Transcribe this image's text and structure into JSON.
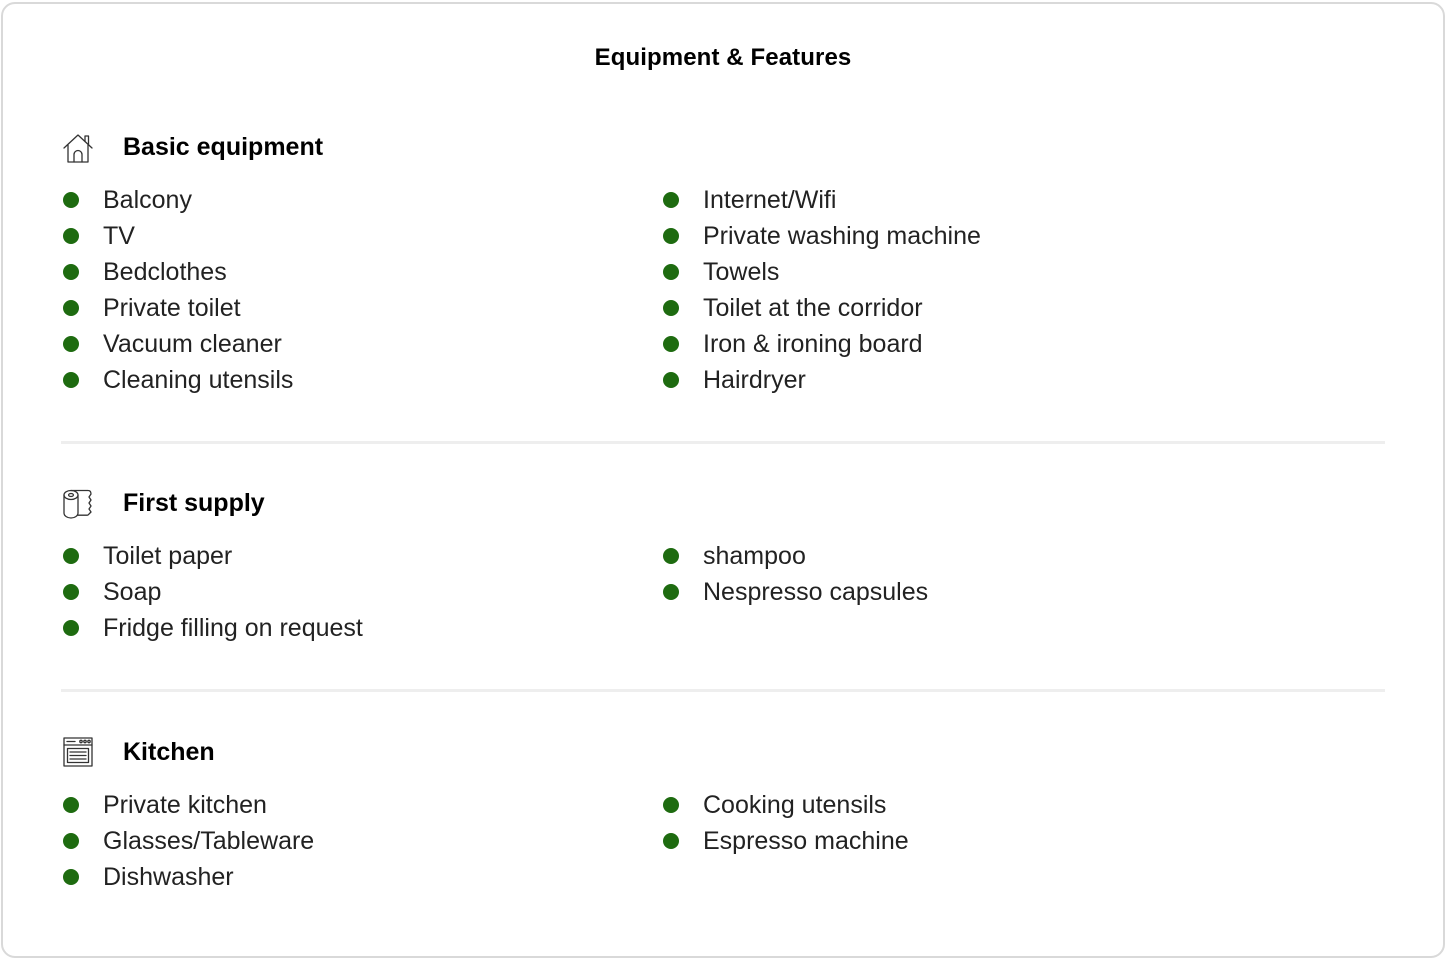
{
  "title": "Equipment & Features",
  "colors": {
    "bullet": "#1e6b10",
    "divider": "#eeeeee",
    "border": "#d9d9d9"
  },
  "sections": [
    {
      "icon": "house-icon",
      "title": "Basic equipment",
      "left": [
        "Balcony",
        "TV",
        "Bedclothes",
        "Private toilet",
        "Vacuum cleaner",
        "Cleaning utensils"
      ],
      "right": [
        "Internet/Wifi",
        "Private washing machine",
        "Towels",
        "Toilet at the corridor",
        "Iron & ironing board",
        "Hairdryer"
      ]
    },
    {
      "icon": "toilet-paper-icon",
      "title": "First supply",
      "left": [
        "Toilet paper",
        "Soap",
        "Fridge filling on request"
      ],
      "right": [
        "shampoo",
        "Nespresso capsules"
      ]
    },
    {
      "icon": "oven-icon",
      "title": "Kitchen",
      "left": [
        "Private kitchen",
        "Glasses/Tableware",
        "Dishwasher"
      ],
      "right": [
        "Cooking utensils",
        "Espresso machine"
      ]
    }
  ]
}
